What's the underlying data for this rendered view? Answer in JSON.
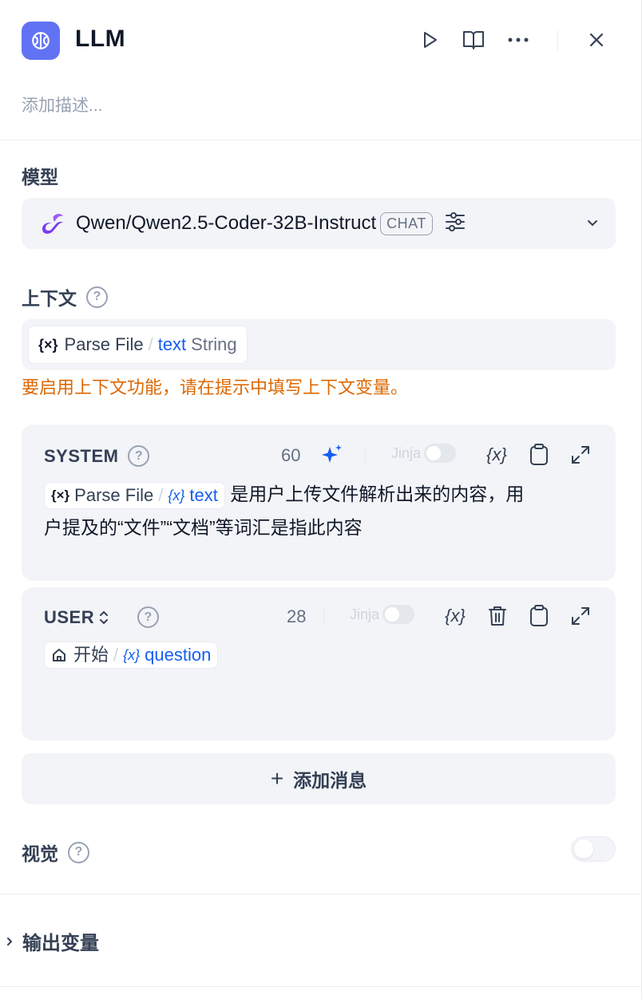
{
  "header": {
    "title": "LLM",
    "description_placeholder": "添加描述..."
  },
  "model_section": {
    "label": "模型",
    "model_name": "Qwen/Qwen2.5-Coder-32B-Instruct",
    "mode_badge": "CHAT"
  },
  "context_section": {
    "label": "上下文",
    "help": "?",
    "var_node": "Parse File",
    "var_name": "text",
    "var_type": "String",
    "warning": "要启用上下文功能，请在提示中填写上下文变量。"
  },
  "system_prompt": {
    "role": "SYSTEM",
    "help": "?",
    "token_count": "60",
    "jinja_label": "Jinja",
    "var_node": "Parse File",
    "var_name": "text",
    "text_line1": "是用户上传文件解析出来的内容，用",
    "text_line2": "户提及的“文件”“文档”等词汇是指此内容"
  },
  "user_prompt": {
    "role": "USER",
    "help": "?",
    "token_count": "28",
    "jinja_label": "Jinja",
    "var_node": "开始",
    "var_name": "question"
  },
  "add_message": {
    "plus": "+",
    "label": "添加消息"
  },
  "vision": {
    "label": "视觉",
    "help": "?",
    "enabled": false
  },
  "output": {
    "label": "输出变量"
  },
  "colors": {
    "accent": "#155eef",
    "icon_bg": "#6172f3",
    "warning": "#dc6803",
    "model_logo": "#7c3aed"
  },
  "icons": [
    "brain-icon",
    "play-icon",
    "book-icon",
    "more-icon",
    "close-icon",
    "model-logo-icon",
    "settings-sliders-icon",
    "chevron-down-icon",
    "help-icon",
    "variable-icon",
    "sparkle-icon",
    "copy-icon",
    "expand-icon",
    "trash-icon",
    "home-icon",
    "chevron-right-icon"
  ]
}
